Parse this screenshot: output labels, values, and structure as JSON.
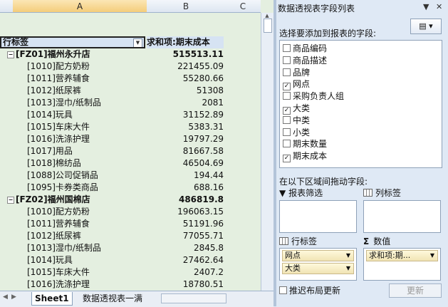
{
  "columns": {
    "a": "A",
    "b": "B",
    "c": "C"
  },
  "pivot": {
    "row_label_header": "行标签",
    "value_header": "求和项:期末成本",
    "rows": [
      {
        "type": "group",
        "label": "[FZ01]福州永升店",
        "value": "515513.11"
      },
      {
        "type": "item",
        "label": "[1010]配方奶粉",
        "value": "221455.09"
      },
      {
        "type": "item",
        "label": "[1011]营养辅食",
        "value": "55280.66"
      },
      {
        "type": "item",
        "label": "[1012]纸尿裤",
        "value": "51308"
      },
      {
        "type": "item",
        "label": "[1013]湿巾/纸制品",
        "value": "2081"
      },
      {
        "type": "item",
        "label": "[1014]玩具",
        "value": "31152.89"
      },
      {
        "type": "item",
        "label": "[1015]车床大件",
        "value": "5383.31"
      },
      {
        "type": "item",
        "label": "[1016]洗涤护理",
        "value": "19797.29"
      },
      {
        "type": "item",
        "label": "[1017]用品",
        "value": "81667.58"
      },
      {
        "type": "item",
        "label": "[1018]棉纺品",
        "value": "46504.69"
      },
      {
        "type": "item",
        "label": "[1088]公司促销品",
        "value": "194.44"
      },
      {
        "type": "item",
        "label": "[1095]卡券类商品",
        "value": "688.16"
      },
      {
        "type": "group",
        "label": "[FZ02]福州国棉店",
        "value": "486819.8"
      },
      {
        "type": "item",
        "label": "[1010]配方奶粉",
        "value": "196063.15"
      },
      {
        "type": "item",
        "label": "[1011]营养辅食",
        "value": "51191.96"
      },
      {
        "type": "item",
        "label": "[1012]纸尿裤",
        "value": "77055.71"
      },
      {
        "type": "item",
        "label": "[1013]湿巾/纸制品",
        "value": "2845.8"
      },
      {
        "type": "item",
        "label": "[1014]玩具",
        "value": "27462.64"
      },
      {
        "type": "item",
        "label": "[1015]车床大件",
        "value": "2407.2"
      },
      {
        "type": "item",
        "label": "[1016]洗涤护理",
        "value": "18780.51"
      }
    ]
  },
  "sheet_tabs": {
    "active": "Sheet1",
    "other": "数据透视表一满"
  },
  "panel": {
    "title": "数据透视表字段列表",
    "choose_label": "选择要添加到报表的字段:",
    "fields": [
      {
        "label": "商品编码",
        "checked": false
      },
      {
        "label": "商品描述",
        "checked": false
      },
      {
        "label": "品牌",
        "checked": false
      },
      {
        "label": "网点",
        "checked": true
      },
      {
        "label": "采购负责人组",
        "checked": false
      },
      {
        "label": "大类",
        "checked": true
      },
      {
        "label": "中类",
        "checked": false
      },
      {
        "label": "小类",
        "checked": false
      },
      {
        "label": "期末数量",
        "checked": false
      },
      {
        "label": "期末成本",
        "checked": true
      }
    ],
    "drag_label": "在以下区域间拖动字段:",
    "filter_label": "报表筛选",
    "column_label": "列标签",
    "row_area_label": "行标签",
    "values_label": "数值",
    "row_fields": [
      "网点",
      "大类"
    ],
    "value_fields": [
      "求和项:期..."
    ],
    "defer_label": "推迟布局更新",
    "update_label": "更新"
  }
}
